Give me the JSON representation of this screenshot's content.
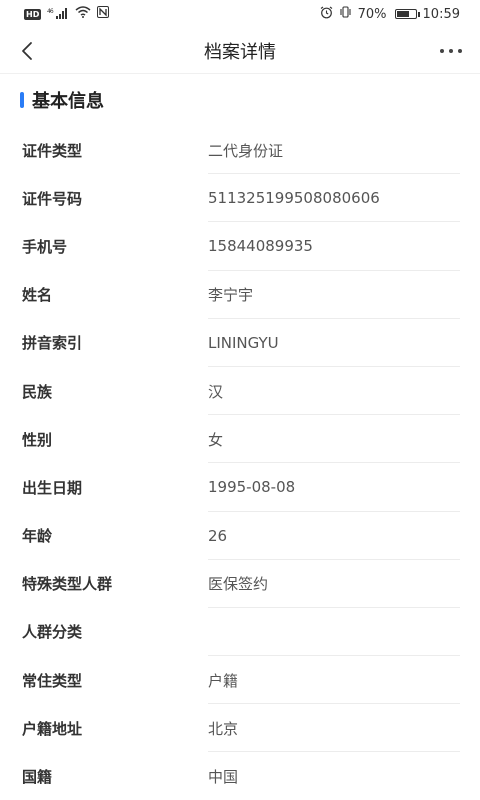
{
  "status_bar": {
    "hd": "HD",
    "network": "46",
    "battery_percent": "70%",
    "battery_level": 0.7,
    "time": "10:59"
  },
  "nav": {
    "title": "档案详情",
    "back_icon": "chevron-left-icon",
    "more_icon": "more-horizontal-icon"
  },
  "section": {
    "title": "基本信息",
    "accent_color": "#2a7cf6"
  },
  "fields": [
    {
      "label": "证件类型",
      "value": "二代身份证"
    },
    {
      "label": "证件号码",
      "value": "511325199508080606"
    },
    {
      "label": "手机号",
      "value": "15844089935"
    },
    {
      "label": "姓名",
      "value": "李宁宇"
    },
    {
      "label": "拼音索引",
      "value": "LININGYU"
    },
    {
      "label": "民族",
      "value": "汉"
    },
    {
      "label": "性别",
      "value": "女"
    },
    {
      "label": "出生日期",
      "value": "1995-08-08"
    },
    {
      "label": "年龄",
      "value": "26"
    },
    {
      "label": "特殊类型人群",
      "value": "医保签约"
    },
    {
      "label": "人群分类",
      "value": ""
    },
    {
      "label": "常住类型",
      "value": "户籍"
    },
    {
      "label": "户籍地址",
      "value": "北京"
    },
    {
      "label": "国籍",
      "value": "中国"
    }
  ]
}
